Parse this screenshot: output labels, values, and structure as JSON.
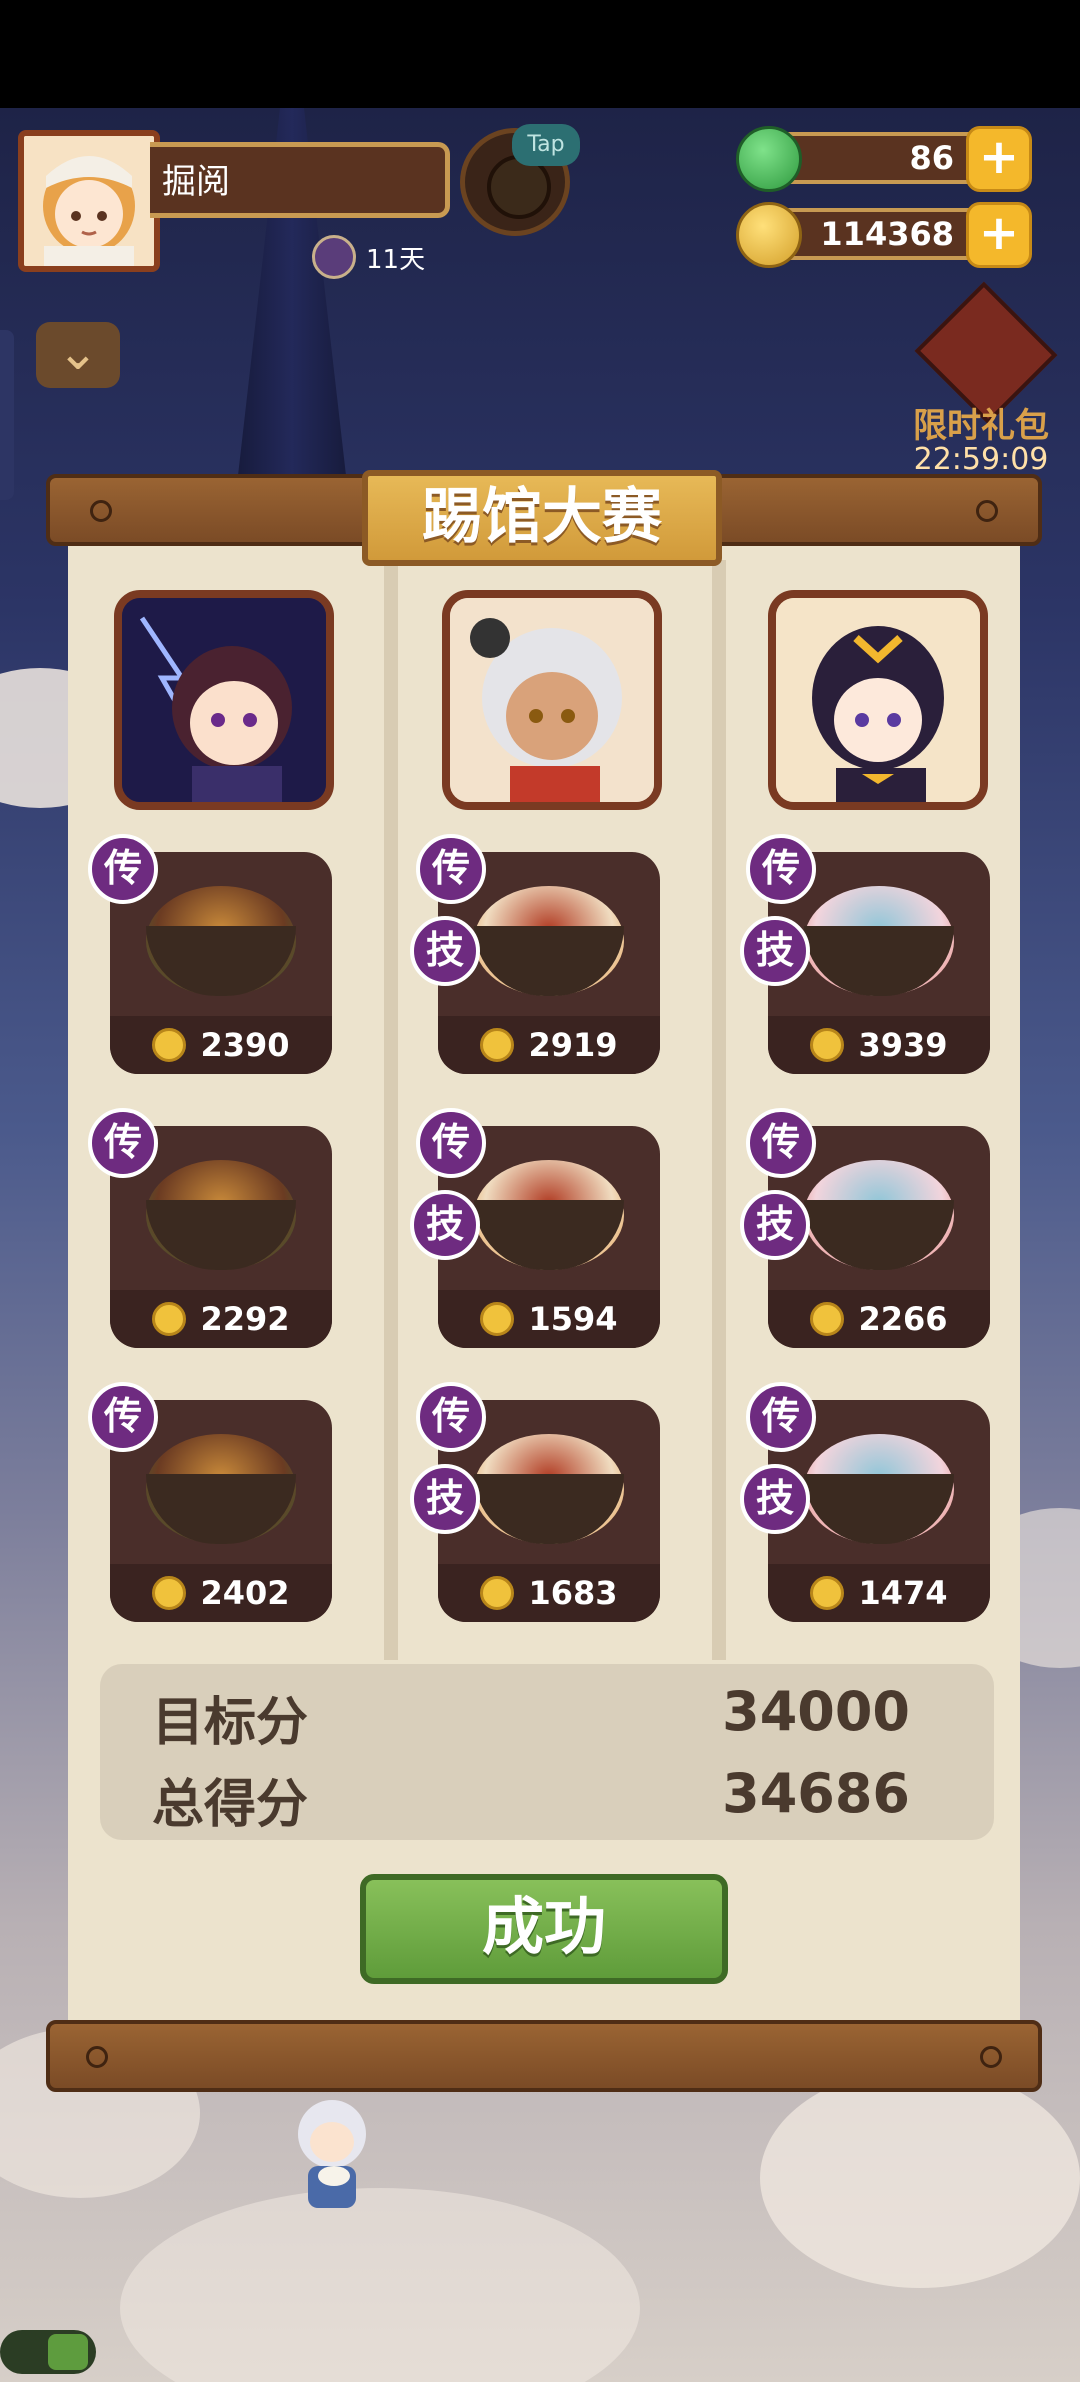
{
  "player": {
    "name": "掘阅",
    "tap_badge": "Tap",
    "days": "11天"
  },
  "resources": {
    "jade": "86",
    "coins": "114368"
  },
  "gift": {
    "label": "限时礼包",
    "timer": "22:59:09"
  },
  "contest": {
    "title": "踢馆大赛",
    "tags": {
      "legend": "传",
      "skill": "技"
    },
    "columns": [
      {
        "dishes": [
          {
            "score": "2390",
            "has_skill": false
          },
          {
            "score": "2292",
            "has_skill": false
          },
          {
            "score": "2402",
            "has_skill": false
          }
        ]
      },
      {
        "dishes": [
          {
            "score": "2919",
            "has_skill": true
          },
          {
            "score": "1594",
            "has_skill": true
          },
          {
            "score": "1683",
            "has_skill": true
          }
        ]
      },
      {
        "dishes": [
          {
            "score": "3939",
            "has_skill": true
          },
          {
            "score": "2266",
            "has_skill": true
          },
          {
            "score": "1474",
            "has_skill": true
          }
        ]
      }
    ],
    "target_label": "目标分",
    "target_value": "34000",
    "total_label": "总得分",
    "total_value": "34686",
    "result_button": "成功"
  },
  "colors": {
    "accent_gold": "#e7b957",
    "panel": "#ece3cd",
    "card": "#4a2e2a",
    "legend_tag": "#6e2b80",
    "success": "#6eaa45"
  }
}
